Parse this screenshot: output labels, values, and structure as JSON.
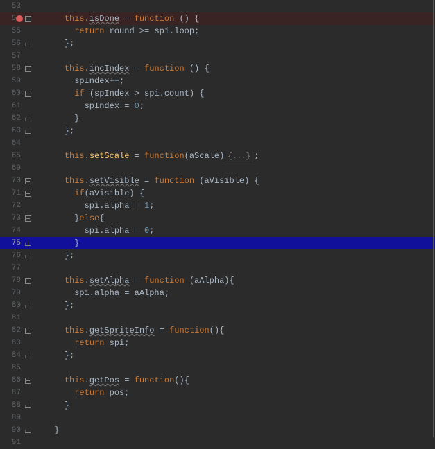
{
  "lines": [
    {
      "num": 53,
      "fold": "line",
      "bp": false,
      "cl": false,
      "html": ""
    },
    {
      "num": 54,
      "fold": "open",
      "bp": true,
      "cl": false,
      "html": "<span class='kw'>this</span>.<span class='def'>isDone</span> = <span class='kw'>function</span> () {"
    },
    {
      "num": 55,
      "fold": "line",
      "bp": false,
      "cl": false,
      "html": "  <span class='kw'>return</span> round &gt;= spi.loop;"
    },
    {
      "num": 56,
      "fold": "close",
      "bp": false,
      "cl": false,
      "html": "};"
    },
    {
      "num": 57,
      "fold": "line",
      "bp": false,
      "cl": false,
      "html": ""
    },
    {
      "num": 58,
      "fold": "open",
      "bp": false,
      "cl": false,
      "html": "<span class='kw'>this</span>.<span class='def'>incIndex</span> = <span class='kw'>function</span> () {"
    },
    {
      "num": 59,
      "fold": "line",
      "bp": false,
      "cl": false,
      "html": "  spIndex++;"
    },
    {
      "num": 60,
      "fold": "open",
      "bp": false,
      "cl": false,
      "html": "  <span class='kw'>if</span> (spIndex &gt; spi.count) {"
    },
    {
      "num": 61,
      "fold": "line",
      "bp": false,
      "cl": false,
      "html": "    spIndex = <span class='num'>0</span>;"
    },
    {
      "num": 62,
      "fold": "close",
      "bp": false,
      "cl": false,
      "html": "  }"
    },
    {
      "num": 63,
      "fold": "close",
      "bp": false,
      "cl": false,
      "html": "};"
    },
    {
      "num": 64,
      "fold": "line",
      "bp": false,
      "cl": false,
      "html": ""
    },
    {
      "num": 65,
      "fold": "line",
      "bp": false,
      "cl": false,
      "html": "<span class='kw'>this</span>.<span class='fn'>setScale</span> = <span class='kw'>function</span>(aScale)<span class='folded-box'>{...}</span>;"
    },
    {
      "num": 69,
      "fold": "line",
      "bp": false,
      "cl": false,
      "html": ""
    },
    {
      "num": 70,
      "fold": "open",
      "bp": false,
      "cl": false,
      "html": "<span class='kw'>this</span>.<span class='def'>setVisible</span> = <span class='kw'>function</span> (aVisible) {"
    },
    {
      "num": 71,
      "fold": "open",
      "bp": false,
      "cl": false,
      "html": "  <span class='kw'>if</span>(aVisible) {"
    },
    {
      "num": 72,
      "fold": "line",
      "bp": false,
      "cl": false,
      "html": "    spi.alpha = <span class='num'>1</span>;"
    },
    {
      "num": 73,
      "fold": "open",
      "bp": false,
      "cl": false,
      "html": "  }<span class='kw'>else</span>{"
    },
    {
      "num": 74,
      "fold": "line",
      "bp": false,
      "cl": false,
      "html": "    spi.alpha = <span class='num'>0</span>;"
    },
    {
      "num": 75,
      "fold": "close",
      "bp": false,
      "cl": true,
      "html": "  }"
    },
    {
      "num": 76,
      "fold": "close",
      "bp": false,
      "cl": false,
      "html": "};"
    },
    {
      "num": 77,
      "fold": "line",
      "bp": false,
      "cl": false,
      "html": ""
    },
    {
      "num": 78,
      "fold": "open",
      "bp": false,
      "cl": false,
      "html": "<span class='kw'>this</span>.<span class='def'>setAlpha</span> = <span class='kw'>function</span> (aAlpha){"
    },
    {
      "num": 79,
      "fold": "line",
      "bp": false,
      "cl": false,
      "html": "  spi.alpha = aAlpha;"
    },
    {
      "num": 80,
      "fold": "close",
      "bp": false,
      "cl": false,
      "html": "};"
    },
    {
      "num": 81,
      "fold": "line",
      "bp": false,
      "cl": false,
      "html": ""
    },
    {
      "num": 82,
      "fold": "open",
      "bp": false,
      "cl": false,
      "html": "<span class='kw'>this</span>.<span class='def'>getSpriteInfo</span> = <span class='kw'>function</span>(){"
    },
    {
      "num": 83,
      "fold": "line",
      "bp": false,
      "cl": false,
      "html": "  <span class='kw'>return</span> spi;"
    },
    {
      "num": 84,
      "fold": "close",
      "bp": false,
      "cl": false,
      "html": "};"
    },
    {
      "num": 85,
      "fold": "line",
      "bp": false,
      "cl": false,
      "html": ""
    },
    {
      "num": 86,
      "fold": "open",
      "bp": false,
      "cl": false,
      "html": "<span class='kw'>this</span>.<span class='def'>getPos</span> = <span class='kw'>function</span>(){"
    },
    {
      "num": 87,
      "fold": "line",
      "bp": false,
      "cl": false,
      "html": "  <span class='kw'>return</span> pos;"
    },
    {
      "num": 88,
      "fold": "close",
      "bp": false,
      "cl": false,
      "html": "}"
    },
    {
      "num": 89,
      "fold": "line",
      "bp": false,
      "cl": false,
      "html": ""
    },
    {
      "num": 90,
      "fold": "close",
      "bp": false,
      "cl": false,
      "indent": -1,
      "html": "}"
    },
    {
      "num": 91,
      "fold": "none",
      "bp": false,
      "cl": false,
      "html": ""
    }
  ],
  "folded_label": "{...}",
  "base_indent": "    "
}
